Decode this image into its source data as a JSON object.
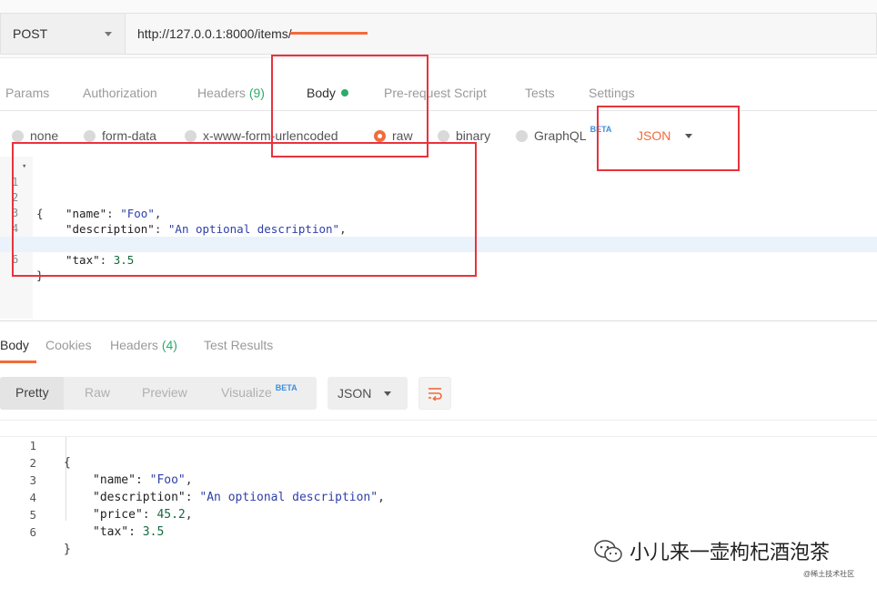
{
  "request": {
    "method": "POST",
    "url": "http://127.0.0.1:8000/items/"
  },
  "request_tabs": [
    {
      "label": "Params"
    },
    {
      "label": "Authorization"
    },
    {
      "label": "Headers",
      "count": "(9)"
    },
    {
      "label": "Body",
      "active": true
    },
    {
      "label": "Pre-request Script"
    },
    {
      "label": "Tests"
    },
    {
      "label": "Settings"
    }
  ],
  "body_types": [
    {
      "label": "none"
    },
    {
      "label": "form-data"
    },
    {
      "label": "x-www-form-urlencoded"
    },
    {
      "label": "raw",
      "checked": true
    },
    {
      "label": "binary"
    },
    {
      "label": "GraphQL",
      "badge": "BETA"
    }
  ],
  "body_format": "JSON",
  "request_lines": [
    "1",
    "2",
    "3",
    "4",
    "5",
    "6"
  ],
  "response_tabs": [
    {
      "label": "Body",
      "active": true
    },
    {
      "label": "Cookies"
    },
    {
      "label": "Headers",
      "count": "(4)"
    },
    {
      "label": "Test Results"
    }
  ],
  "response_views": [
    {
      "label": "Pretty",
      "active": true
    },
    {
      "label": "Raw"
    },
    {
      "label": "Preview"
    },
    {
      "label": "Visualize",
      "badge": "BETA"
    }
  ],
  "response_format": "JSON",
  "response_lines": [
    "1",
    "2",
    "3",
    "4",
    "5",
    "6"
  ],
  "json_body": {
    "open": "{",
    "close": "}",
    "fields": [
      {
        "key": "\"name\"",
        "value": "\"Foo\"",
        "type": "string",
        "comma": ","
      },
      {
        "key": "\"description\"",
        "value": "\"An optional description\"",
        "type": "string",
        "comma": ","
      },
      {
        "key": "\"price\"",
        "value": "45.2",
        "type": "number",
        "comma": ","
      },
      {
        "key": "\"tax\"",
        "value": "3.5",
        "type": "number",
        "comma": ""
      }
    ]
  },
  "watermark": {
    "title": "小儿来一壶枸杞酒泡茶",
    "subtitle": "@稀土技术社区"
  },
  "colors": {
    "accent": "#f26b3a",
    "success": "#2eaa6a",
    "beta": "#3b8fe0",
    "annotation": "#e8333c"
  }
}
